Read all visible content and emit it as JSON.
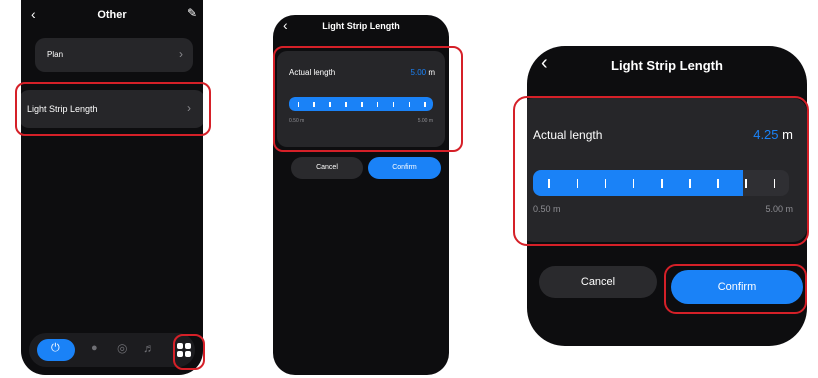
{
  "screen1": {
    "title": "Other",
    "items": [
      {
        "label": "Plan",
        "chevron": "›"
      },
      {
        "label": "Light Strip Length",
        "chevron": "›"
      }
    ],
    "bottom_bar": {
      "power_icon": "power-icon",
      "bulb_icon": "bulb-icon",
      "palette_icon": "palette-icon",
      "music_icon": "music-icon",
      "grid_icon": "grid-icon"
    }
  },
  "screen2": {
    "title": "Light Strip Length",
    "label": "Actual length",
    "value": "5.00",
    "unit": "m",
    "min_label": "0.50 m",
    "max_label": "5.00 m",
    "fill_fraction": 1.0,
    "cancel_label": "Cancel",
    "confirm_label": "Confirm"
  },
  "screen3": {
    "title": "Light Strip Length",
    "label": "Actual length",
    "value": "4.25",
    "unit": "m",
    "min_label": "0.50 m",
    "max_label": "5.00 m",
    "fill_fraction": 0.82,
    "cancel_label": "Cancel",
    "confirm_label": "Confirm"
  },
  "colors": {
    "accent": "#1a82f7",
    "highlight": "#d52028",
    "background": "#0d0d0f",
    "card": "#262629"
  }
}
